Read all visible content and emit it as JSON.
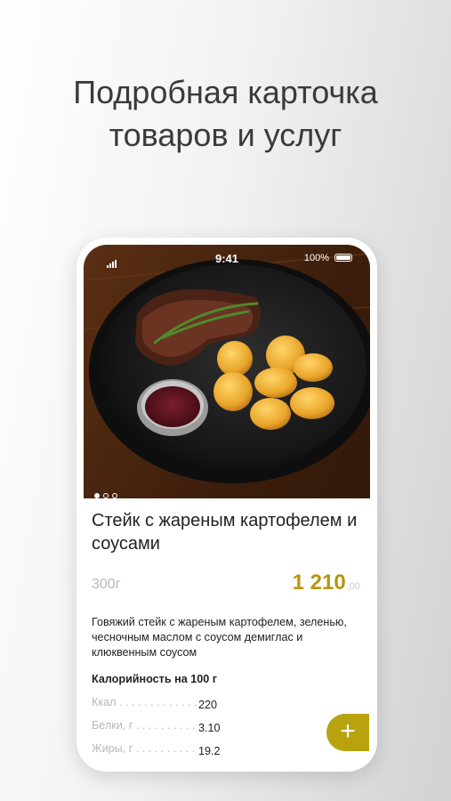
{
  "headline": {
    "line1": "Подробная карточка",
    "line2": "товаров и услуг"
  },
  "status": {
    "time": "9:41",
    "battery": "100%"
  },
  "gallery": {
    "slides": 3,
    "active": 0
  },
  "product": {
    "title": "Стейк с жареным картофелем и соусами",
    "weight": "300г",
    "price": "1 210",
    "price_fraction": ",00",
    "description": "Говяжий стейк с жареным картофелем, зеленью, чесночным маслом с соусом демиглас и клюквенным соусом",
    "calories_title": "Калорийность на 100 г",
    "nutrition": [
      {
        "label": "Ккал",
        "value": "220"
      },
      {
        "label": "Белки, г",
        "value": "3.10"
      },
      {
        "label": "Жиры, г",
        "value": "19.2"
      }
    ]
  },
  "fab": {
    "label": "+"
  },
  "colors": {
    "accent": "#b8960d",
    "fab": "#b8a30f"
  }
}
